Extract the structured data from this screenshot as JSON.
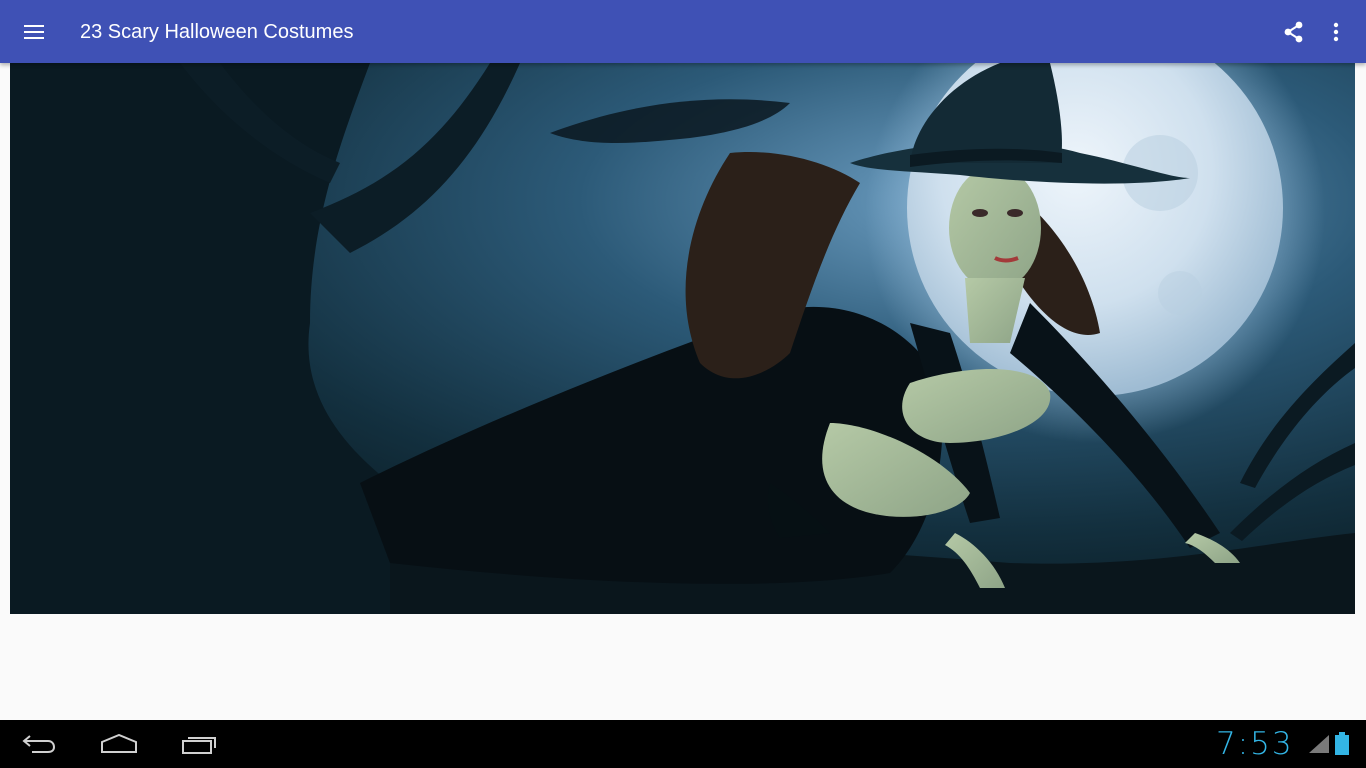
{
  "app_bar": {
    "title": "23 Scary Halloween Costumes",
    "menu_icon": "hamburger-menu-icon",
    "share_icon": "share-icon",
    "overflow_icon": "more-vert-icon",
    "color": "#3f51b5"
  },
  "content": {
    "image_subject": "witch-under-full-moon",
    "background": "#fafafa"
  },
  "system_bar": {
    "time": "7:53",
    "time_color": "#33b5e5",
    "back_icon": "back-icon",
    "home_icon": "home-icon",
    "recents_icon": "recent-apps-icon",
    "signal_icon": "signal-icon",
    "battery_icon": "battery-icon"
  }
}
